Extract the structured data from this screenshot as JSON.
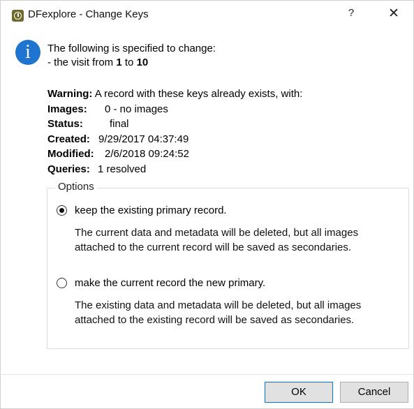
{
  "window": {
    "title": "DFexplore - Change Keys",
    "help_label": "?",
    "close_label": "✕"
  },
  "message": {
    "icon": "info-icon",
    "line1": "The following is specified to change:",
    "line2_prefix": "- the visit from ",
    "from_value": "1",
    "to_word": " to ",
    "to_value": "10"
  },
  "details": {
    "warning_label": "Warning:",
    "warning_text": " A record with these keys already exists, with:",
    "images_label": "Images:",
    "images_value": "0 - no images",
    "status_label": "Status:",
    "status_value": "final",
    "created_label": "Created:",
    "created_value": "9/29/2017 04:37:49",
    "modified_label": "Modified:",
    "modified_value": "2/6/2018 09:24:52",
    "queries_label": "Queries:",
    "queries_value": "1 resolved"
  },
  "options": {
    "legend": "Options",
    "selected_index": 0,
    "items": [
      {
        "label": "keep the existing primary record.",
        "description": "The current data and metadata will be deleted, but all images attached to the current record will be saved as secondaries."
      },
      {
        "label": "make the current record the new primary.",
        "description": "The existing data and metadata will be deleted, but all images attached to the existing record will be saved as secondaries."
      }
    ]
  },
  "buttons": {
    "ok": "OK",
    "cancel": "Cancel"
  },
  "colors": {
    "info_icon": "#1f74d0",
    "app_icon": "#6e6a2c",
    "default_button_border": "#0078d7"
  }
}
